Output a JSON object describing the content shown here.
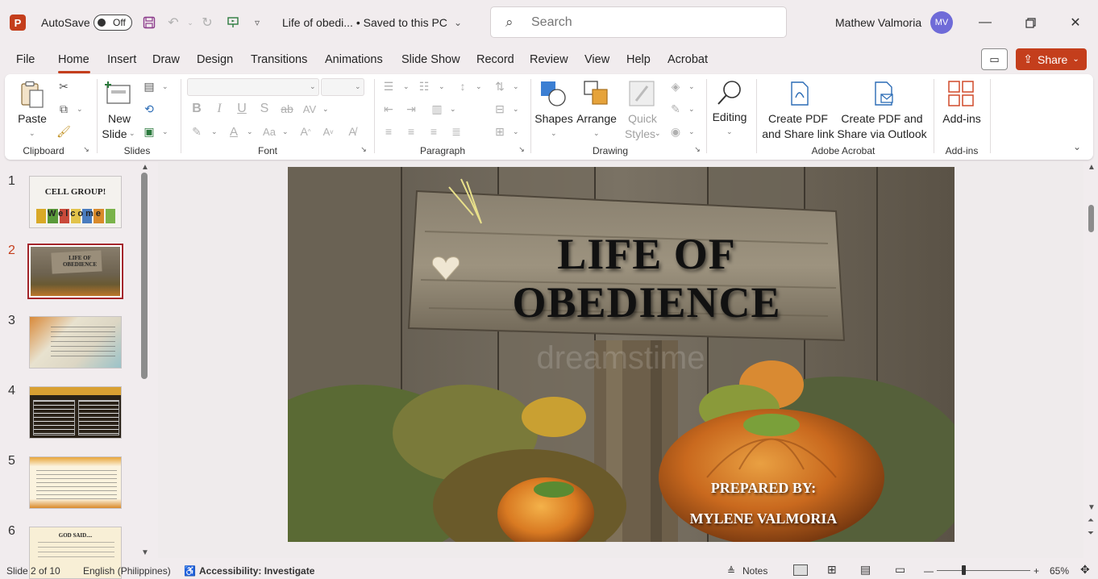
{
  "titlebar": {
    "app_letter": "P",
    "autosave_label": "AutoSave",
    "autosave_state": "Off",
    "doc_title": "Life of obedi...  •  Saved to this PC",
    "search_placeholder": "Search",
    "user_name": "Mathew Valmoria",
    "user_initials": "MV"
  },
  "menu": {
    "tabs": [
      "File",
      "Home",
      "Insert",
      "Draw",
      "Design",
      "Transitions",
      "Animations",
      "Slide Show",
      "Record",
      "Review",
      "View",
      "Help",
      "Acrobat"
    ],
    "share_label": "Share"
  },
  "ribbon": {
    "paste": "Paste",
    "clipboard": "Clipboard",
    "new_slide_1": "New",
    "new_slide_2": "Slide",
    "slides": "Slides",
    "font_btns": [
      "B",
      "I",
      "U",
      "S",
      "ab",
      "AV"
    ],
    "font": "Font",
    "paragraph": "Paragraph",
    "shapes": "Shapes",
    "arrange": "Arrange",
    "quick_1": "Quick",
    "quick_2": "Styles",
    "drawing": "Drawing",
    "editing": "Editing",
    "pdf1_1": "Create PDF",
    "pdf1_2": "and Share link",
    "pdf2_1": "Create PDF and",
    "pdf2_2": "Share via Outlook",
    "adobe": "Adobe Acrobat",
    "addins": "Add-ins",
    "addins_group": "Add-ins"
  },
  "slides": [
    {
      "num": "1",
      "title": "CELL GROUP!",
      "sub": "Welcome"
    },
    {
      "num": "2",
      "title": "LIFE OF OBEDIENCE",
      "sub": ""
    },
    {
      "num": "3",
      "title": "",
      "sub": ""
    },
    {
      "num": "4",
      "title": "",
      "sub": ""
    },
    {
      "num": "5",
      "title": "",
      "sub": ""
    },
    {
      "num": "6",
      "title": "GOD SAID....",
      "sub": ""
    }
  ],
  "slide": {
    "title_1": "LIFE OF",
    "title_2": "OBEDIENCE",
    "prepared": "PREPARED BY:",
    "author": "MYLENE VALMORIA",
    "watermark": "dreamstime"
  },
  "status": {
    "slide_of": "Slide 2 of 10",
    "language": "English (Philippines)",
    "accessibility": "Accessibility: Investigate",
    "notes": "Notes",
    "zoom": "65%"
  }
}
